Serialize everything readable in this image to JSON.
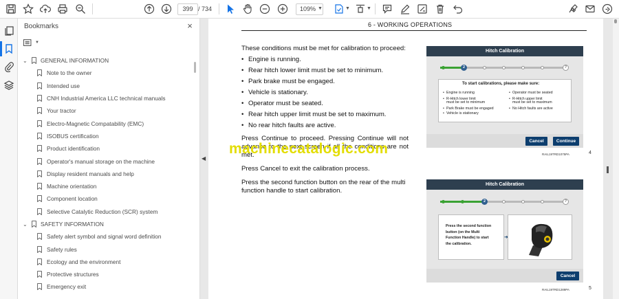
{
  "toolbar": {
    "page_current": "399",
    "page_total": "/ 734",
    "zoom": "109%"
  },
  "bookmarks": {
    "title": "Bookmarks",
    "close": "×",
    "items": [
      {
        "label": "GENERAL INFORMATION",
        "level": 0
      },
      {
        "label": "Note to the owner",
        "level": 1
      },
      {
        "label": "Intended use",
        "level": 1
      },
      {
        "label": "CNH Industrial America LLC technical manuals",
        "level": 1
      },
      {
        "label": "Your tractor",
        "level": 1
      },
      {
        "label": "Electro-Magnetic Compatability (EMC)",
        "level": 1
      },
      {
        "label": "ISOBUS certification",
        "level": 1
      },
      {
        "label": "Product identification",
        "level": 1
      },
      {
        "label": "Operator's manual storage on the machine",
        "level": 1
      },
      {
        "label": "Display resident manuals and help",
        "level": 1
      },
      {
        "label": "Machine orientation",
        "level": 1
      },
      {
        "label": "Component location",
        "level": 1
      },
      {
        "label": "Selective Catalytic Reduction (SCR) system",
        "level": 1
      },
      {
        "label": "SAFETY INFORMATION",
        "level": 0
      },
      {
        "label": "Safety alert symbol and signal word definition",
        "level": 1
      },
      {
        "label": "Safety rules",
        "level": 1
      },
      {
        "label": "Ecology and the environment",
        "level": 1
      },
      {
        "label": "Protective structures",
        "level": 1
      },
      {
        "label": "Emergency exit",
        "level": 1
      }
    ]
  },
  "document": {
    "section_heading": "6 - WORKING OPERATIONS",
    "intro": "These conditions must be met for calibration to proceed:",
    "conditions": [
      "Engine is running.",
      "Rear hitch lower limit must be set to minimum.",
      "Park brake must be engaged.",
      "Vehicle is stationary.",
      "Operator must be seated.",
      "Rear hitch upper limit must be set to maximum.",
      "No rear hitch faults are active."
    ],
    "para_continue": "Press Continue to proceed.  Pressing Continue will not advance to the next screen if all the conditions are not met.",
    "para_cancel": "Press Cancel to exit the calibration process.",
    "para_second": "Press the second function button on the rear of the multi function handle to start calibration.",
    "watermark": "machinecatalogic.com"
  },
  "figure1": {
    "title": "Hitch Calibration",
    "step": "2",
    "last_step": "?",
    "card_title": "To start calibrations, please make sure:",
    "left_conditions": [
      "Engine is running",
      "R-Hitch lower limit",
      "must be set to minimum",
      "Park Brake must be engaged",
      "Vehicle is stationary"
    ],
    "right_conditions": [
      "Operator must be seated",
      "R-Hitch upper limit",
      "must be set to maximum",
      "No Hitch faults are active"
    ],
    "cancel": "Cancel",
    "continue": "Continue",
    "code": "RAIL19TRD1075PA",
    "number": "4"
  },
  "figure2": {
    "title": "Hitch Calibration",
    "step": "2",
    "last_step": "?",
    "instruction": [
      "Press the second function",
      "button (on the Multi",
      "Function Handle) to start",
      "the calibration."
    ],
    "cancel": "Cancel",
    "code": "RAIL19TRD1289PA",
    "number": "5"
  },
  "colors": {
    "accent_blue": "#1473e6",
    "figure_header": "#2e3f4f",
    "figure_button": "#0d3e6e",
    "progress_green": "#3aa233",
    "watermark_yellow": "#e3dd00"
  },
  "icons": [
    "save-icon",
    "star-icon",
    "upload-icon",
    "print-icon",
    "zoom-search-icon",
    "prev-page-icon",
    "next-page-icon",
    "select-cursor-icon",
    "hand-icon",
    "zoom-out-icon",
    "zoom-in-icon",
    "fit-page-icon",
    "comment-icon",
    "pen-icon",
    "eraser-icon",
    "delete-icon",
    "undo-icon",
    "sign-icon",
    "mail-icon",
    "share-icon"
  ]
}
